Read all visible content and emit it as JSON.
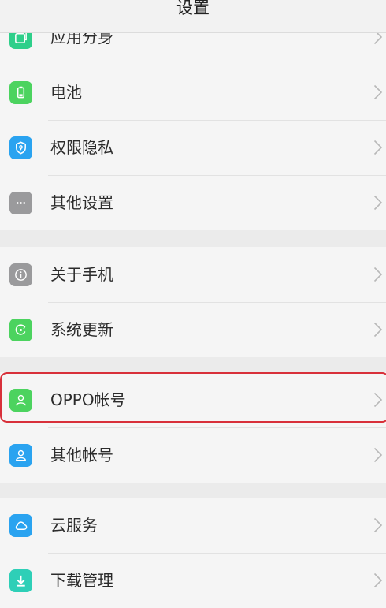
{
  "header": {
    "title": "设置"
  },
  "groups": [
    {
      "items": [
        {
          "label": "应用分身",
          "icon": "app-clone-icon",
          "color": "#2ecf8a"
        },
        {
          "label": "电池",
          "icon": "battery-icon",
          "color": "#4cd35f"
        },
        {
          "label": "权限隐私",
          "icon": "shield-icon",
          "color": "#2aa3f0"
        },
        {
          "label": "其他设置",
          "icon": "more-dots-icon",
          "color": "#9a9a9c"
        }
      ]
    },
    {
      "items": [
        {
          "label": "关于手机",
          "icon": "info-icon",
          "color": "#9a9a9c"
        },
        {
          "label": "系统更新",
          "icon": "update-icon",
          "color": "#4cd35f"
        }
      ]
    },
    {
      "items": [
        {
          "label": "OPPO帐号",
          "icon": "user-icon",
          "color": "#4cd35f"
        },
        {
          "label": "其他帐号",
          "icon": "user-outline-icon",
          "color": "#2aa3f0"
        }
      ]
    },
    {
      "items": [
        {
          "label": "云服务",
          "icon": "cloud-icon",
          "color": "#2aa3f0"
        },
        {
          "label": "下载管理",
          "icon": "download-icon",
          "color": "#2ecfb7"
        }
      ]
    }
  ],
  "colors": {
    "highlight": "#d8303a",
    "chevron": "#b8b8b8"
  }
}
